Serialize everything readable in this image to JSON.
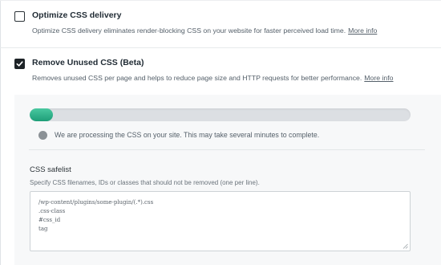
{
  "options": [
    {
      "id": "optimize-css-delivery",
      "title": "Optimize CSS delivery",
      "description": "Optimize CSS delivery eliminates render-blocking CSS on your website for faster perceived load time.",
      "link": "More info",
      "checked": false
    },
    {
      "id": "remove-unused-css",
      "title": "Remove Unused CSS (Beta)",
      "description": "Removes unused CSS per page and helps to reduce page size and HTTP requests for better performance.",
      "link": "More info",
      "checked": true
    }
  ],
  "progress": {
    "value_percent": 6,
    "fill_color": "#27a57f",
    "status_text": "We are processing the CSS on your site. This may take several minutes to complete."
  },
  "safelist": {
    "title": "CSS safelist",
    "description": "Specify CSS filenames, IDs or classes that should not be removed (one per line).",
    "lines": [
      "/wp-content/plugins/some-plugin/(.*).css",
      ".css-class",
      "#css_id",
      "tag"
    ]
  }
}
